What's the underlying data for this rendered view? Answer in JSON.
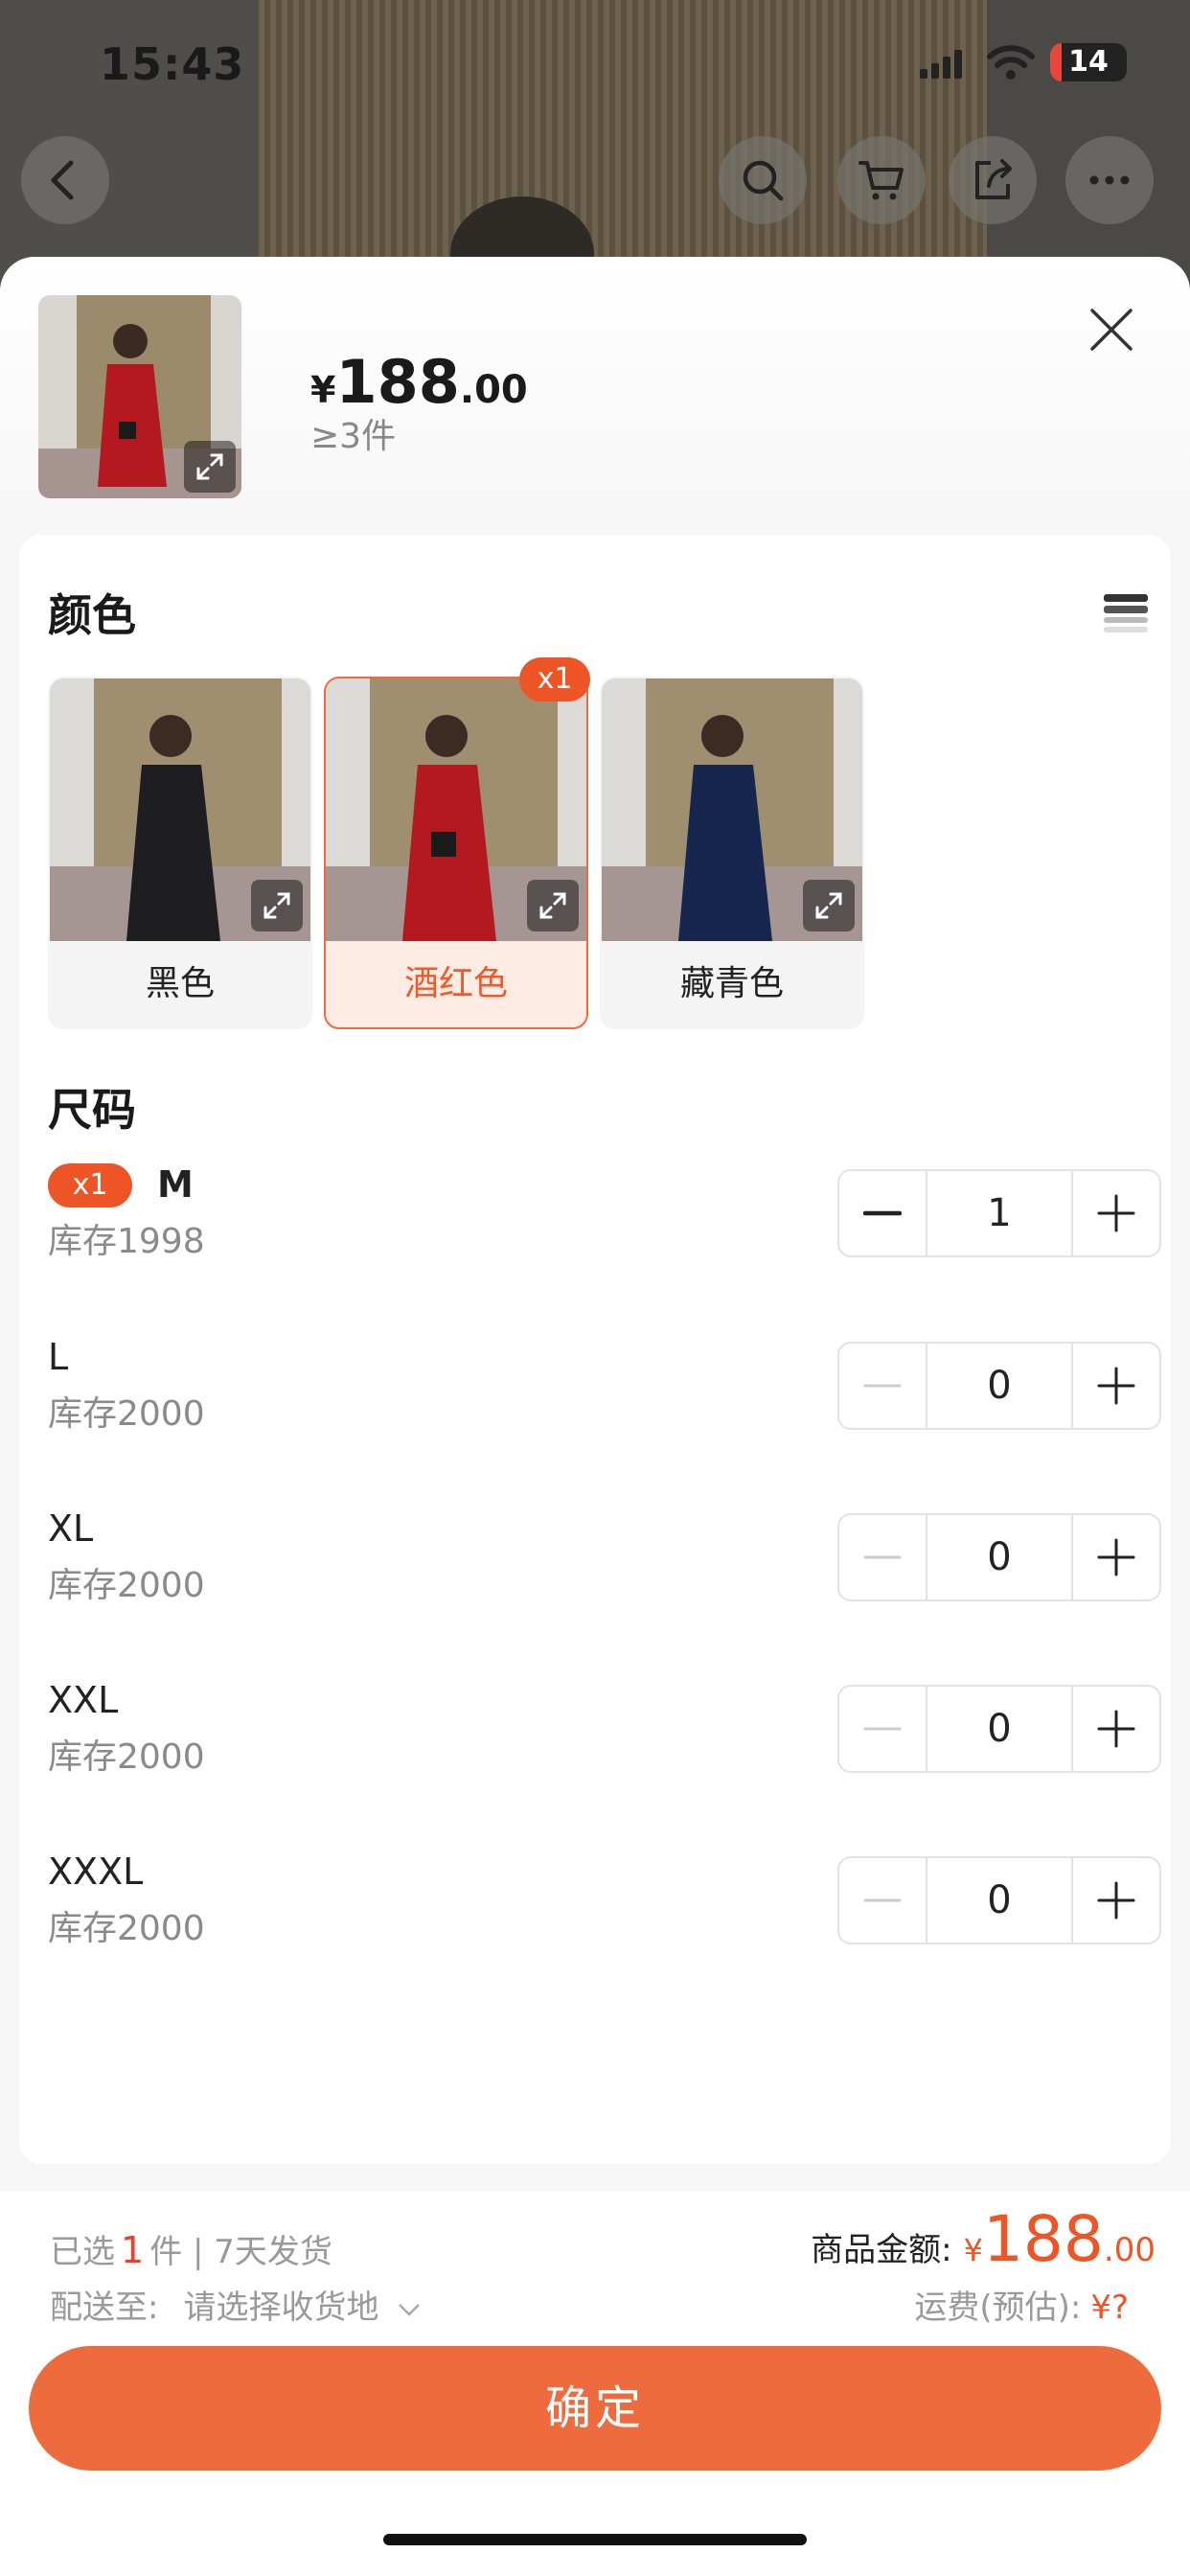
{
  "status_bar": {
    "time": "15:43",
    "battery": "14"
  },
  "product": {
    "price_currency": "¥",
    "price_integer": "188",
    "price_decimal": ".00",
    "min_order": "≥3件"
  },
  "color_section": {
    "title": "颜色",
    "options": [
      {
        "label": "黑色",
        "selected": false,
        "coat_color": "#1d1d22"
      },
      {
        "label": "酒红色",
        "selected": true,
        "badge": "x1",
        "coat_color": "#b3191f"
      },
      {
        "label": "藏青色",
        "selected": false,
        "coat_color": "#16264f"
      }
    ]
  },
  "size_section": {
    "title": "尺码",
    "sizes": [
      {
        "name": "M",
        "stock": "库存1998",
        "qty": "1",
        "badge": "x1"
      },
      {
        "name": "L",
        "stock": "库存2000",
        "qty": "0"
      },
      {
        "name": "XL",
        "stock": "库存2000",
        "qty": "0"
      },
      {
        "name": "XXL",
        "stock": "库存2000",
        "qty": "0"
      },
      {
        "name": "XXXL",
        "stock": "库存2000",
        "qty": "0"
      }
    ]
  },
  "footer": {
    "selected_prefix": "已选",
    "selected_count": "1",
    "selected_suffix": "件 | 7天发货",
    "ship_label": "配送至:",
    "ship_placeholder": "请选择收货地",
    "amount_label": "商品金额:",
    "amount_currency": "¥",
    "amount_integer": "188",
    "amount_decimal": ".00",
    "freight_label": "运费(预估):",
    "freight_value": "¥?",
    "confirm_label": "确定"
  },
  "colors": {
    "accent": "#ee6b3e",
    "badge": "#ee5526"
  }
}
